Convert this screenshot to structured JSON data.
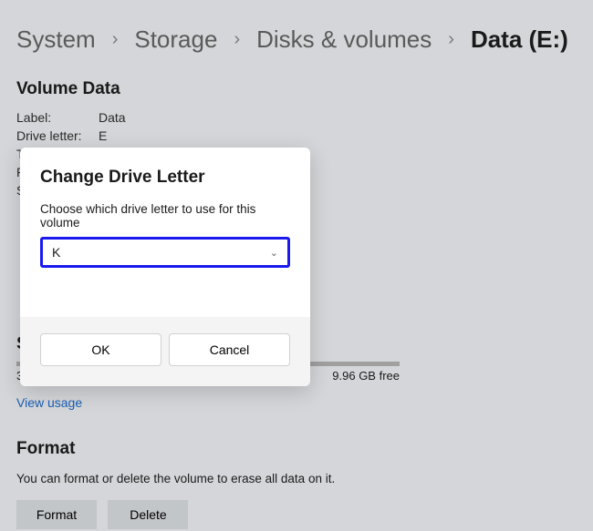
{
  "breadcrumb": {
    "items": [
      "System",
      "Storage",
      "Disks & volumes",
      "Data (E:)"
    ]
  },
  "volumeData": {
    "title": "Volume Data",
    "rows": [
      {
        "label": "Label:",
        "value": "Data"
      },
      {
        "label": "Drive letter:",
        "value": "E"
      }
    ],
    "partialRows": [
      "T",
      "P",
      "S"
    ]
  },
  "storage": {
    "sectionLetter": "S",
    "leftText": "3",
    "rightText": "9.96 GB free"
  },
  "viewUsage": "View usage",
  "format": {
    "title": "Format",
    "desc": "You can format or delete the volume to erase all data on it.",
    "formatBtn": "Format",
    "deleteBtn": "Delete"
  },
  "dialog": {
    "title": "Change Drive Letter",
    "desc": "Choose which drive letter to use for this volume",
    "selected": "K",
    "okBtn": "OK",
    "cancelBtn": "Cancel"
  }
}
